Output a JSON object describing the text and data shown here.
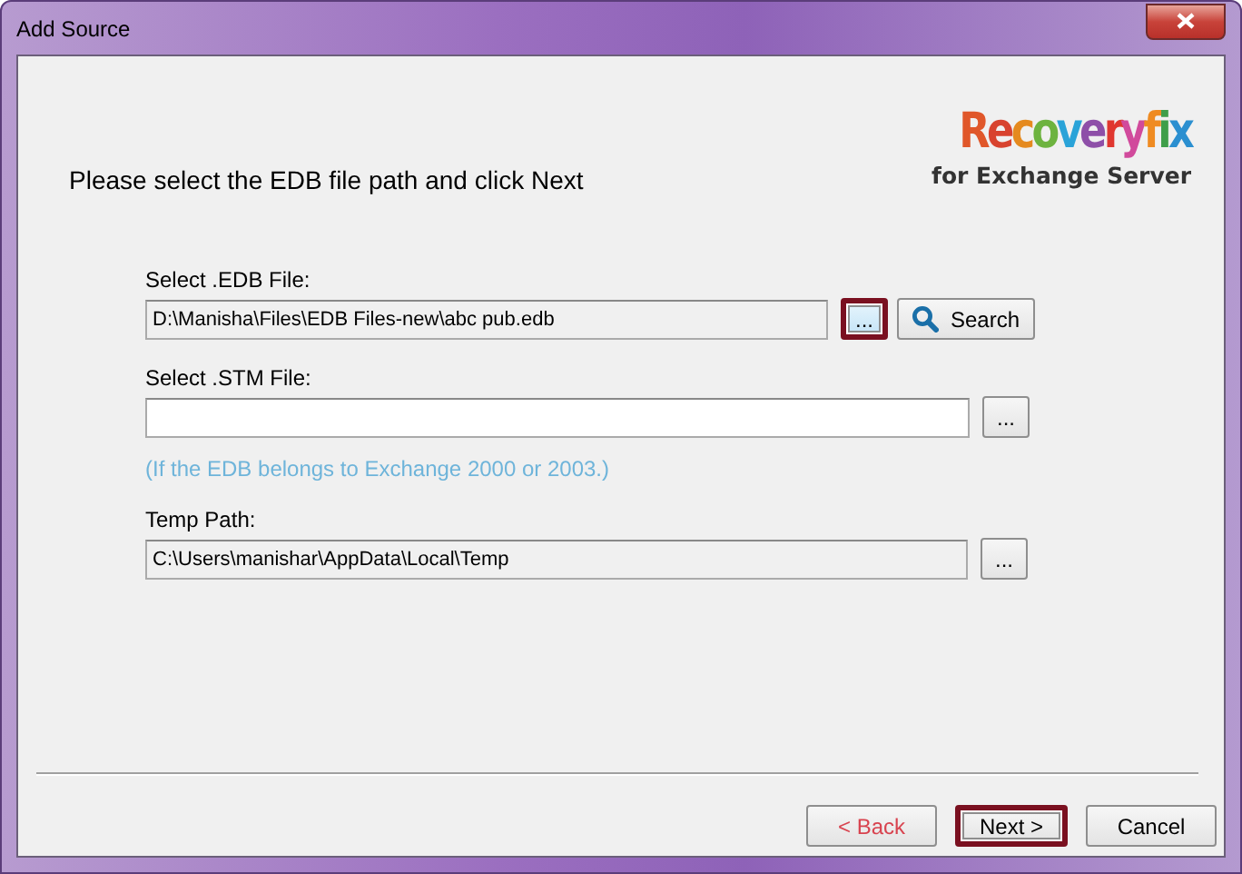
{
  "window": {
    "title": "Add Source"
  },
  "logo": {
    "name": "Recoveryfix",
    "subtitle": "for Exchange Server"
  },
  "instruction": "Please select the EDB file path and click Next",
  "fields": [
    {
      "label": "Select .EDB File:",
      "value": "D:\\Manisha\\Files\\EDB Files-new\\abc pub.edb",
      "browse": "...",
      "browse_highlighted": true,
      "search": "Search",
      "readonly": true
    },
    {
      "label": "Select .STM File:",
      "browse": "...",
      "browse_highlighted": false,
      "hint": "(If the EDB belongs to Exchange 2000 or 2003.)",
      "readonly": false
    },
    {
      "label": "Temp Path:",
      "value": "C:\\Users\\manishar\\AppData\\Local\\Temp",
      "browse": "...",
      "browse_highlighted": false,
      "readonly": true
    }
  ],
  "buttons": [
    {
      "label": "< Back",
      "highlighted": false,
      "color": "#d8434f"
    },
    {
      "label": "Next >",
      "highlighted": true
    },
    {
      "label": "Cancel",
      "highlighted": false
    }
  ]
}
